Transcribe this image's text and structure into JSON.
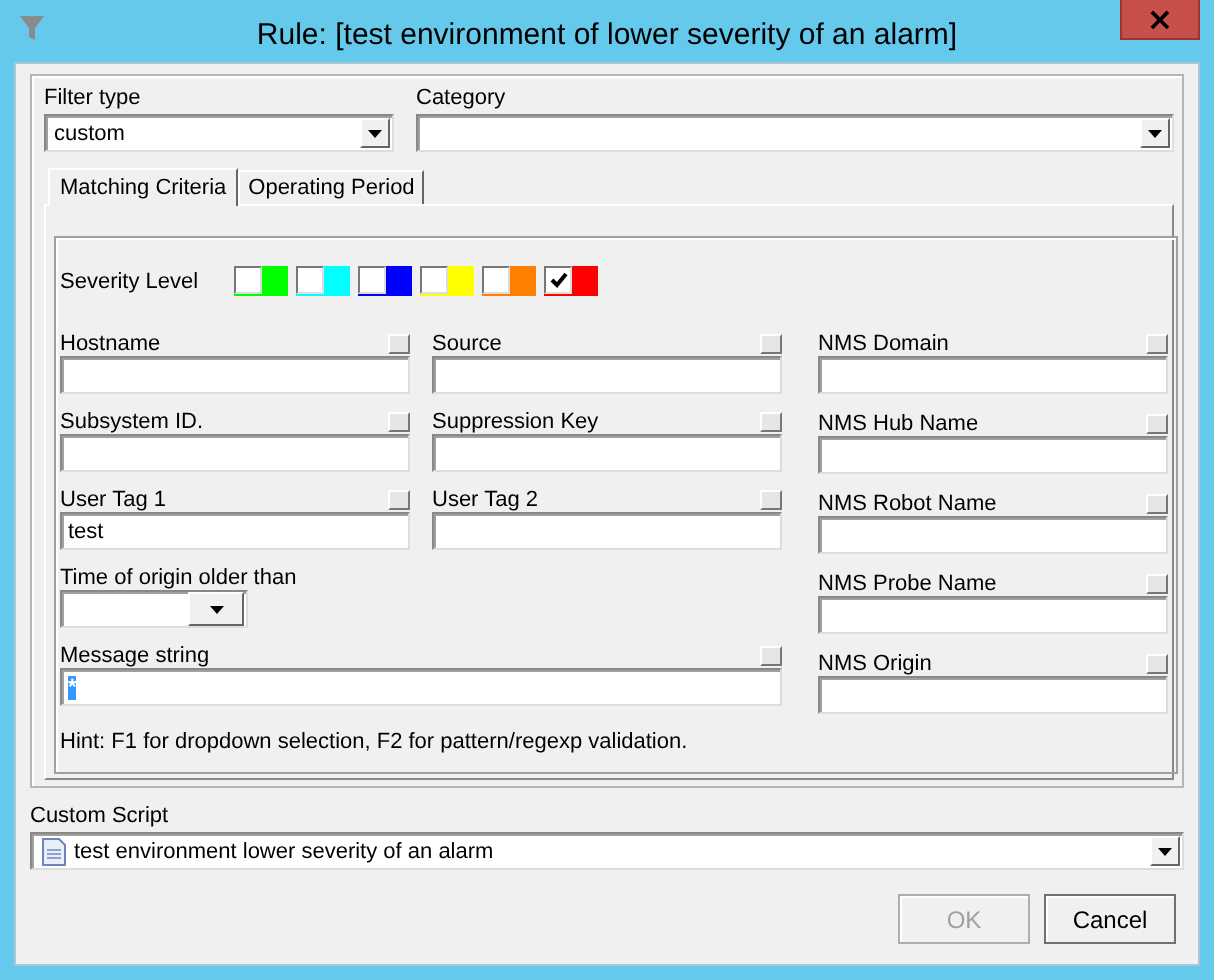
{
  "window": {
    "title": "Rule: [test environment of lower severity of an alarm]",
    "close": "×"
  },
  "filter_type": {
    "label": "Filter type",
    "value": "custom"
  },
  "category": {
    "label": "Category"
  },
  "tabs": [
    {
      "label": "Matching Criteria",
      "selected": true
    },
    {
      "label": "Operating Period",
      "selected": false
    }
  ],
  "severity": {
    "label": "Severity Level",
    "levels": [
      {
        "color": "#00ff00",
        "checked": false
      },
      {
        "color": "#00ffff",
        "checked": false
      },
      {
        "color": "#0000ff",
        "checked": false
      },
      {
        "color": "#ffff00",
        "checked": false
      },
      {
        "color": "#ff8000",
        "checked": false
      },
      {
        "color": "#ff0000",
        "checked": true
      }
    ]
  },
  "left_fields": [
    {
      "label": "Hostname",
      "kind": "text"
    },
    {
      "label": "Source",
      "kind": "text"
    },
    {
      "label": "Subsystem ID.",
      "kind": "text"
    },
    {
      "label": "Suppression Key",
      "kind": "text"
    },
    {
      "label": "User Tag 1",
      "kind": "text",
      "value": "test"
    },
    {
      "label": "User Tag 2",
      "kind": "text"
    },
    {
      "label": "Time of origin older than",
      "kind": "dropdown"
    },
    {
      "label": "Message string",
      "kind": "wide",
      "value": "*",
      "value_selected": true
    }
  ],
  "right_fields": [
    {
      "label": "NMS Domain"
    },
    {
      "label": "NMS Hub Name"
    },
    {
      "label": "NMS Robot Name"
    },
    {
      "label": "NMS Probe Name"
    },
    {
      "label": "NMS Origin"
    }
  ],
  "hint": "Hint: F1 for dropdown selection, F2 for pattern/regexp validation.",
  "custom_script": {
    "label": "Custom Script",
    "value": "test environment lower severity of an alarm"
  },
  "buttons": [
    {
      "label": "OK",
      "disabled": true
    },
    {
      "label": "Cancel",
      "disabled": false
    }
  ]
}
